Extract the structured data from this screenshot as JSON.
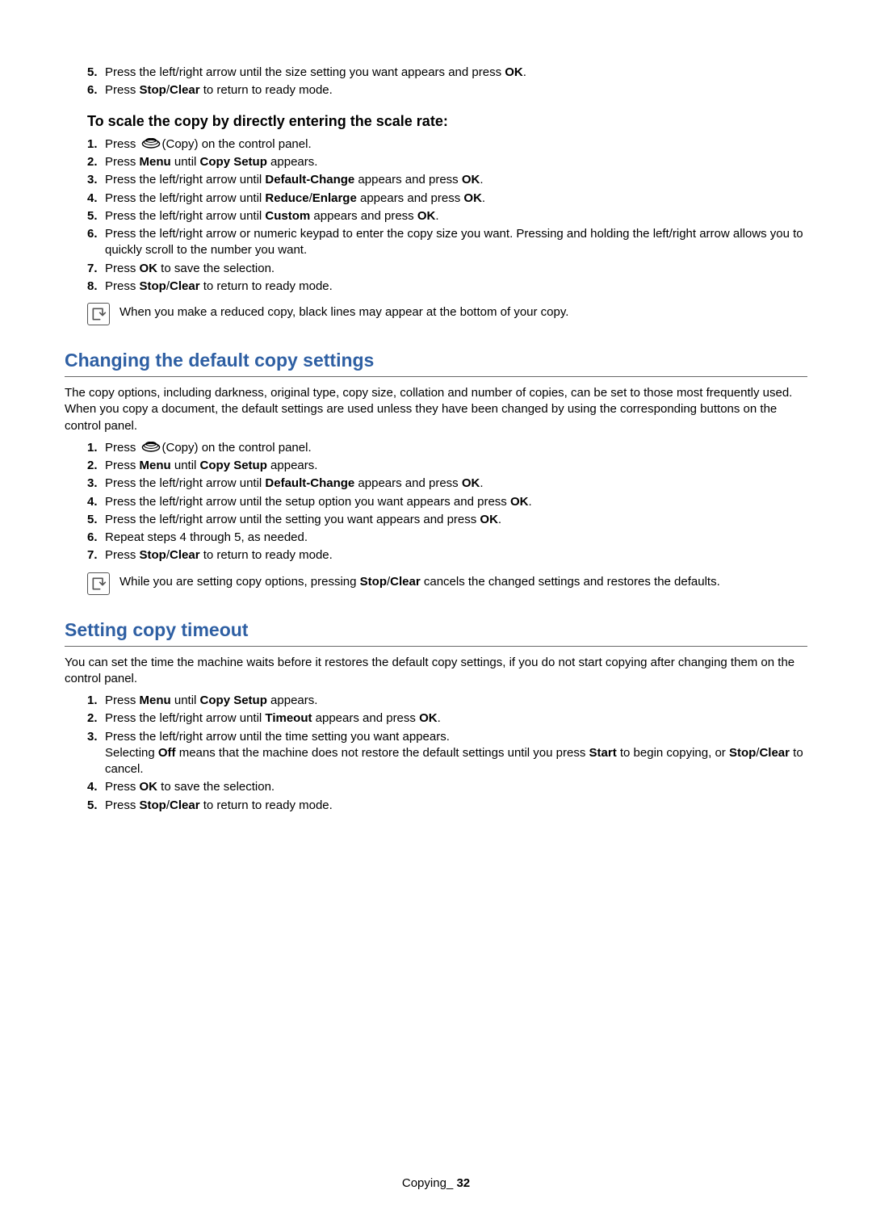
{
  "topList": [
    {
      "n": "5.",
      "html": "Press the left/right arrow until the size setting you want appears and press <strong>OK</strong>."
    },
    {
      "n": "6.",
      "html": "Press <strong>Stop</strong>/<strong>Clear</strong> to return to ready mode."
    }
  ],
  "subhead1": "To scale the copy by directly entering the scale rate:",
  "scaleList": [
    {
      "n": "1.",
      "html": "Press <span class=\"copy-glyph\"><svg viewBox=\"0 0 34 20\"><ellipse cx=\"17\" cy=\"10\" rx=\"15\" ry=\"7\" fill=\"none\" stroke=\"#000\" stroke-width=\"2\"/><ellipse cx=\"17\" cy=\"7\" rx=\"12\" ry=\"5\" fill=\"none\" stroke=\"#000\" stroke-width=\"1.5\"/><ellipse cx=\"17\" cy=\"4\" rx=\"9\" ry=\"3.5\" fill=\"none\" stroke=\"#000\" stroke-width=\"1.5\"/></svg></span>(Copy) on the control panel."
    },
    {
      "n": "2.",
      "html": "Press <strong>Menu</strong> until <strong>Copy Setup</strong> appears."
    },
    {
      "n": "3.",
      "html": "Press the left/right arrow until <strong>Default-Change</strong> appears and press <strong>OK</strong>."
    },
    {
      "n": "4.",
      "html": "Press the left/right arrow until <strong>Reduce</strong>/<strong>Enlarge</strong> appears and press <strong>OK</strong>."
    },
    {
      "n": "5.",
      "html": "Press the left/right arrow until <strong>Custom</strong> appears and press <strong>OK</strong>."
    },
    {
      "n": "6.",
      "html": "Press the left/right arrow or numeric keypad to enter the copy size you want. Pressing and holding the left/right arrow allows you to quickly scroll to the number you want."
    },
    {
      "n": "7.",
      "html": "Press <strong>OK</strong> to save the selection."
    },
    {
      "n": "8.",
      "html": "Press <strong>Stop</strong>/<strong>Clear</strong> to return to ready mode."
    }
  ],
  "note1": "When you make a reduced copy, black lines may appear at the bottom of your copy.",
  "sectionA": {
    "title": "Changing the default copy settings",
    "intro": "The copy options, including darkness, original type, copy size, collation and number of copies, can be set to those most frequently used. When you copy a document, the default settings are used unless they have been changed by using the corresponding buttons on the control panel.",
    "list": [
      {
        "n": "1.",
        "html": "Press <span class=\"copy-glyph\"><svg viewBox=\"0 0 34 20\"><ellipse cx=\"17\" cy=\"10\" rx=\"15\" ry=\"7\" fill=\"none\" stroke=\"#000\" stroke-width=\"2\"/><ellipse cx=\"17\" cy=\"7\" rx=\"12\" ry=\"5\" fill=\"none\" stroke=\"#000\" stroke-width=\"1.5\"/><ellipse cx=\"17\" cy=\"4\" rx=\"9\" ry=\"3.5\" fill=\"none\" stroke=\"#000\" stroke-width=\"1.5\"/></svg></span>(Copy) on the control panel."
      },
      {
        "n": "2.",
        "html": "Press <strong>Menu</strong> until <strong>Copy Setup</strong> appears."
      },
      {
        "n": "3.",
        "html": "Press the left/right arrow until <strong>Default-Change</strong> appears and press <strong>OK</strong>."
      },
      {
        "n": "4.",
        "html": "Press the left/right arrow until the setup option you want appears and press <strong>OK</strong>."
      },
      {
        "n": "5.",
        "html": "Press the left/right arrow until the setting you want appears and press <strong>OK</strong>."
      },
      {
        "n": "6.",
        "html": "Repeat steps 4 through 5, as needed."
      },
      {
        "n": "7.",
        "html": "Press <strong>Stop</strong>/<strong>Clear</strong> to return to ready mode."
      }
    ],
    "note": "While you are setting copy options, pressing <strong>Stop</strong>/<strong>Clear</strong> cancels the changed settings and restores the defaults."
  },
  "sectionB": {
    "title": "Setting copy timeout",
    "intro": "You can set the time the machine waits before it restores the default copy settings, if you do not start copying after changing them on the control panel.",
    "list": [
      {
        "n": "1.",
        "html": "Press <strong>Menu</strong> until <strong>Copy Setup</strong> appears."
      },
      {
        "n": "2.",
        "html": "Press the left/right arrow until <strong>Timeout</strong> appears and press <strong>OK</strong>."
      },
      {
        "n": "3.",
        "html": "Press the left/right arrow until the time setting you want appears.<br>Selecting <strong>Off</strong> means that the machine does not restore the default settings until you press <strong>Start</strong> to begin copying, or <strong>Stop</strong>/<strong>Clear</strong> to cancel."
      },
      {
        "n": "4.",
        "html": "Press <strong>OK</strong> to save the selection."
      },
      {
        "n": "5.",
        "html": "Press <strong>Stop</strong>/<strong>Clear</strong> to return to ready mode."
      }
    ]
  },
  "footer": {
    "label": "Copying",
    "sep": "_ ",
    "page": "32"
  }
}
